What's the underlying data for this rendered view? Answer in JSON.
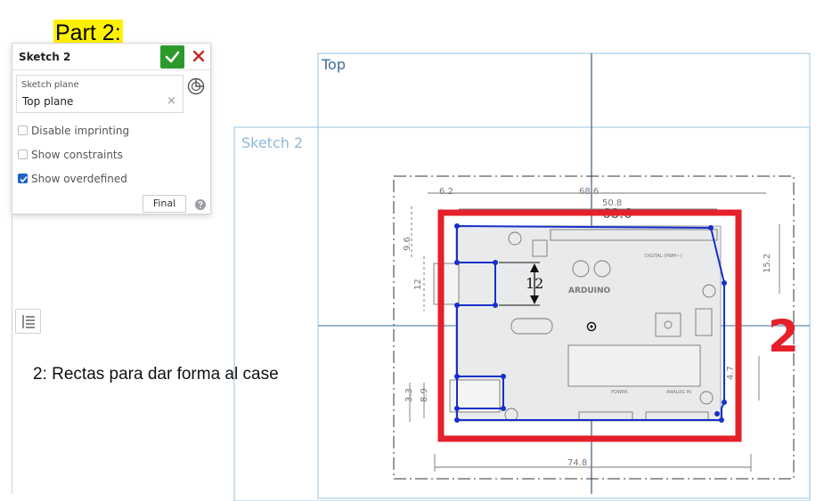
{
  "heading": "Part 2:",
  "panel": {
    "title": "Sketch 2",
    "sketch_plane_label": "Sketch plane",
    "sketch_plane_value": "Top plane",
    "clear_symbol": "×",
    "options": [
      {
        "label": "Disable imprinting",
        "checked": false
      },
      {
        "label": "Show constraints",
        "checked": false
      },
      {
        "label": "Show overdefined",
        "checked": true
      }
    ],
    "final_label": "Final",
    "accept_color": "#2b9a2b",
    "cancel_color": "#c62828"
  },
  "note": "2:  Rectas para dar forma al case",
  "viewport": {
    "plane_top_label": "Top",
    "sketch_label": "Sketch 2",
    "dim_top_1": "6.2",
    "dim_top_2": "68.6",
    "dim_top_3": "50.8",
    "dim_top_4": "68.6",
    "dim_left_1": "9.6",
    "dim_left_2": "12",
    "dim_left_3": "3.3",
    "dim_left_4": "8.9",
    "dim_right_1": "15.2",
    "dim_right_2": "4.7",
    "dim_bottom": "74.8",
    "sketch_dimension": "12",
    "board_brand": "ARDUINO",
    "board_digital": "DIGITAL (PWM~)",
    "board_power": "POWER",
    "board_analog": "ANALOG IN",
    "annotation": "2",
    "sketch_color": "#1730c9",
    "highlight_color": "#e5202a",
    "plane_color": "#a9cde6"
  }
}
